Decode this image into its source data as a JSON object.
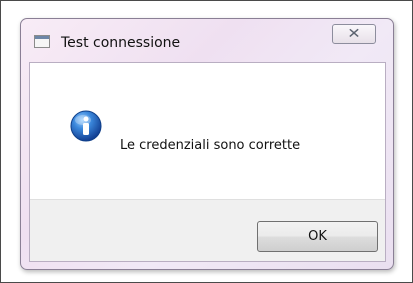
{
  "window": {
    "title": "Test connessione",
    "close_label": "✕",
    "icon": "window-app-icon"
  },
  "dialog": {
    "message": "Le credenziali sono corrette",
    "icon": "info-icon",
    "ok_label": "OK"
  },
  "colors": {
    "title_bar_tint": "#efe0f1",
    "info_blue": "#2f63b8",
    "button_gray": "#ebebeb",
    "button_border": "#707070"
  }
}
